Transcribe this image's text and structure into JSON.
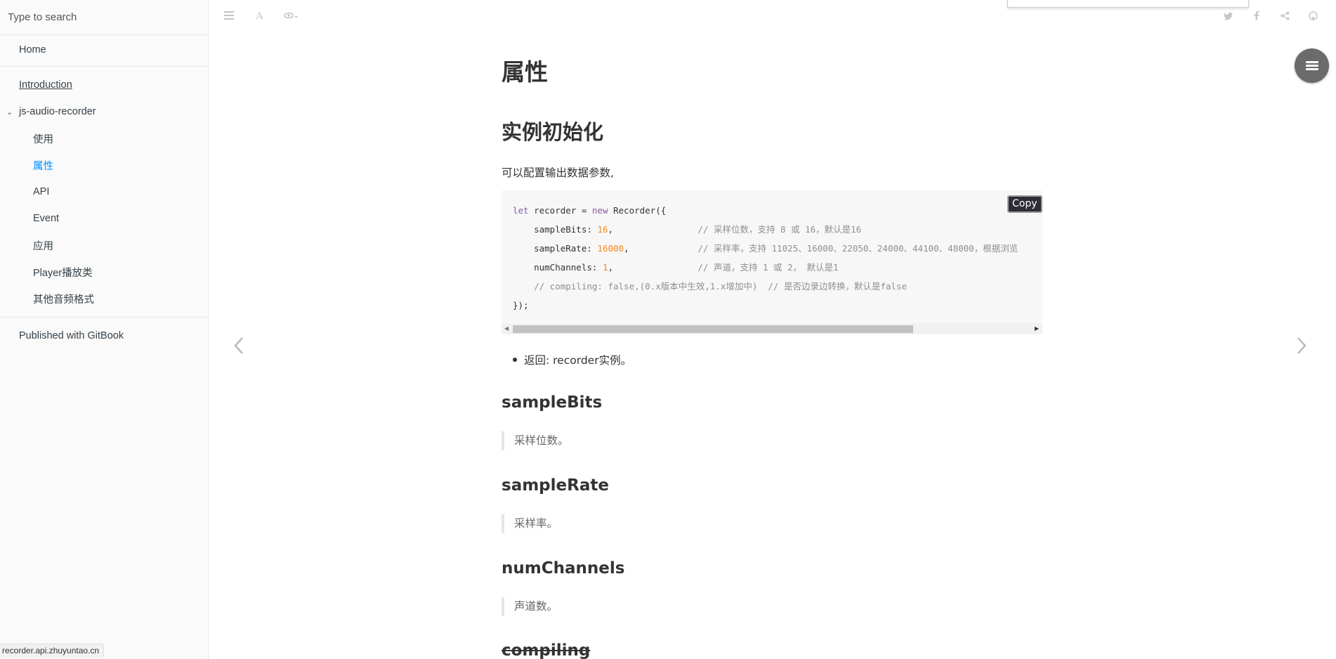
{
  "search": {
    "placeholder": "Type to search"
  },
  "sidebar": {
    "home": "Home",
    "introduction": "Introduction",
    "section_title": "js-audio-recorder",
    "chevron": "⌄",
    "items": [
      {
        "label": "使用"
      },
      {
        "label": "属性"
      },
      {
        "label": "API"
      },
      {
        "label": "Event"
      },
      {
        "label": "应用"
      },
      {
        "label": "Player播放类"
      },
      {
        "label": "其他音频格式"
      }
    ],
    "published": "Published with GitBook"
  },
  "status_url": "recorder.api.zhuyuntao.cn",
  "toolbar": {
    "left_icons": [
      "menu-icon",
      "font-icon",
      "eye-icon"
    ],
    "right_icons": [
      "twitter-icon",
      "facebook-icon",
      "share-icon",
      "github-icon"
    ]
  },
  "page": {
    "title": "属性",
    "section1": "实例初始化",
    "intro": "可以配置输出数据参数,",
    "copy_label": "Copy",
    "code_lines": [
      "let recorder = new Recorder({",
      "    sampleBits: 16,                 // 采样位数，支持 8 或 16，默认是16",
      "    sampleRate: 16000,              // 采样率，支持 11025、16000、22050、24000、44100、48000，根据浏览",
      "    numChannels: 1,                 // 声道，支持 1 或 2， 默认是1",
      "    // compiling: false,(0.x版本中生效,1.x增加中)  // 是否边录边转换，默认是false",
      "});"
    ],
    "bullet": "返回: recorder实例。",
    "h_samplebits": "sampleBits",
    "q_samplebits": "采样位数。",
    "h_samplerate": "sampleRate",
    "q_samplerate": "采样率。",
    "h_numchannels": "numChannels",
    "q_numchannels": "声道数。",
    "h_compiling": "compiling"
  },
  "colors": {
    "accent": "#008cff",
    "sidebar_bg": "#fafafa"
  }
}
